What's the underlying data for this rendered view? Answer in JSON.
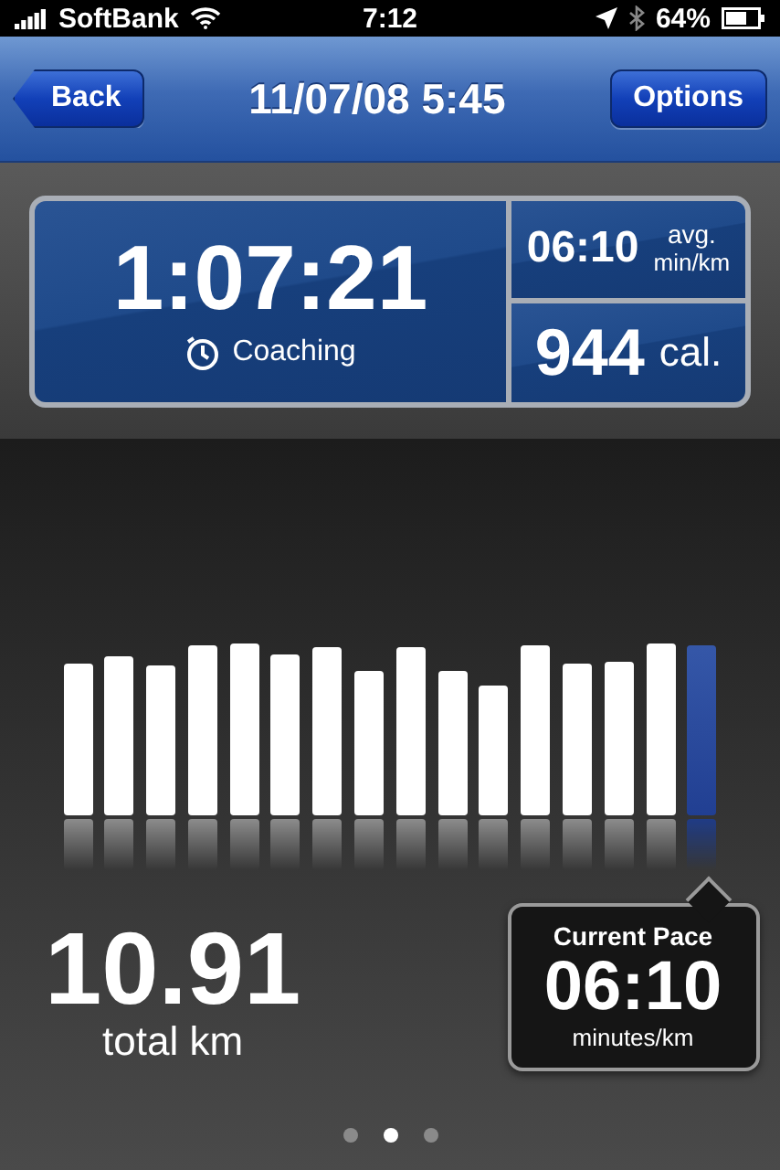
{
  "status_bar": {
    "carrier": "SoftBank",
    "time": "7:12",
    "battery": "64%"
  },
  "nav_bar": {
    "back": "Back",
    "title": "11/07/08 5:45",
    "options": "Options"
  },
  "summary": {
    "duration": "1:07:21",
    "coaching": "Coaching",
    "avg_pace": "06:10",
    "avg_pace_label_1": "avg.",
    "avg_pace_label_2": "min/km",
    "calories": "944",
    "calories_unit": "cal."
  },
  "pace_bars": [
    {
      "selected": false
    },
    {
      "selected": false
    },
    {
      "selected": false
    },
    {
      "selected": false
    },
    {
      "selected": false
    },
    {
      "selected": false
    },
    {
      "selected": false
    },
    {
      "selected": false
    },
    {
      "selected": false
    },
    {
      "selected": false
    },
    {
      "selected": false
    },
    {
      "selected": false
    },
    {
      "selected": false
    },
    {
      "selected": false
    },
    {
      "selected": false
    },
    {
      "selected": true
    }
  ],
  "distance": {
    "value": "10.91",
    "label": "total km"
  },
  "current_pace": {
    "title": "Current Pace",
    "value": "06:10",
    "unit": "minutes/km"
  },
  "page_dots": [
    {
      "selected": false
    },
    {
      "selected": true
    },
    {
      "selected": false
    }
  ]
}
